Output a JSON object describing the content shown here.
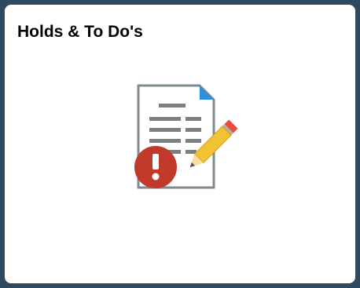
{
  "tile": {
    "title": "Holds & To Do's",
    "icon": "document-pencil-alert-icon"
  },
  "colors": {
    "frame_border": "#2f4a5e",
    "tile_background": "#ffffff",
    "document_fill": "#ffffff",
    "document_outline": "#7f8a8f",
    "document_lines": "#7a7f82",
    "document_corner": "#2f8fd8",
    "alert_badge": "#c0392b",
    "pencil_body": "#f1c232",
    "pencil_eraser": "#e74c3c"
  }
}
